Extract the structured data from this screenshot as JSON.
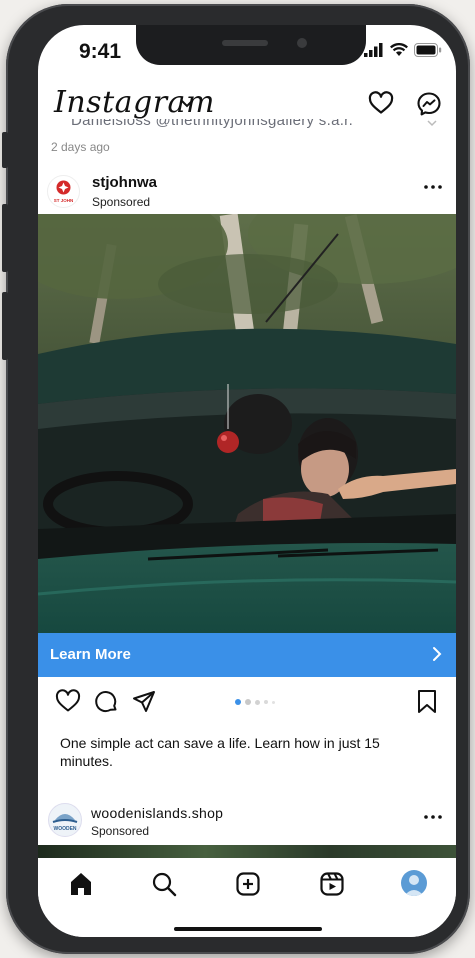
{
  "status": {
    "time": "9:41"
  },
  "header": {
    "logo": "Instagram"
  },
  "previous_post": {
    "cut_text": "Danielsloss @thetrinityjohnsgallery s.a.r.",
    "time_ago": "2 days ago"
  },
  "post": {
    "username": "stjohnwa",
    "sponsored": "Sponsored",
    "avatar_text": "ST JOHN",
    "cta": "Learn More",
    "caption": "One simple act can save a life. Learn how in just 15 minutes.",
    "carousel_total": 5,
    "carousel_active": 1
  },
  "post2": {
    "username": "woodenislands.shop",
    "sponsored": "Sponsored",
    "avatar_text": "WOODEN"
  },
  "colors": {
    "cta_blue": "#3a90e8",
    "frame": "#2a2b2d",
    "accent_red": "#d42a2a"
  },
  "tabbar": {
    "icons": [
      "home-icon",
      "search-icon",
      "new-post-icon",
      "reels-icon",
      "profile-icon"
    ]
  }
}
